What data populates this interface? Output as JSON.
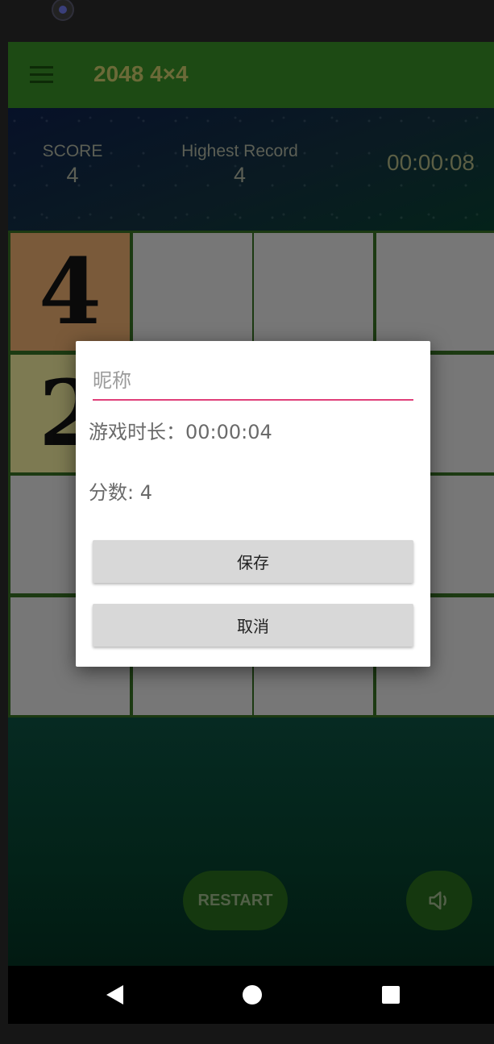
{
  "app": {
    "title": "2048 4×4"
  },
  "stats": {
    "score_label": "SCORE",
    "score_value": "4",
    "record_label": "Highest Record",
    "record_value": "4",
    "timer": "00:00:08"
  },
  "board": {
    "tiles": [
      [
        "4",
        "",
        "",
        ""
      ],
      [
        "2",
        "",
        "",
        ""
      ],
      [
        "",
        "",
        "",
        ""
      ],
      [
        "",
        "",
        "",
        ""
      ]
    ]
  },
  "controls": {
    "restart_label": "RESTART",
    "sound_icon": "speaker-icon"
  },
  "dialog": {
    "nickname_placeholder": "昵称",
    "duration_text": "游戏时长：00:00:04",
    "score_text": "分数: 4",
    "save_label": "保存",
    "cancel_label": "取消"
  },
  "navbar": {
    "back_icon": "back-icon",
    "home_icon": "home-icon",
    "recent_icon": "recents-icon"
  },
  "colors": {
    "accent": "#e0407a",
    "app_bar": "#1d4a14"
  }
}
